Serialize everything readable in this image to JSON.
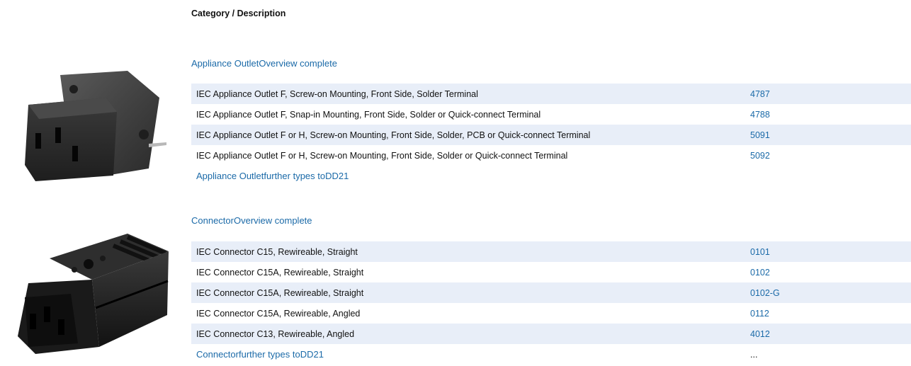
{
  "header": {
    "title": "Category / Description"
  },
  "sections": [
    {
      "title": "Appliance OutletOverview complete",
      "image_icon": "iec-appliance-outlet-image",
      "rows": [
        {
          "description": "IEC Appliance Outlet F, Screw-on Mounting, Front Side, Solder Terminal",
          "code": "4787"
        },
        {
          "description": "IEC Appliance Outlet F, Snap-in Mounting, Front Side, Solder or Quick-connect Terminal",
          "code": "4788"
        },
        {
          "description": "IEC Appliance Outlet F or H, Screw-on Mounting, Front Side, Solder, PCB or Quick-connect Terminal",
          "code": "5091"
        },
        {
          "description": "IEC Appliance Outlet F or H, Screw-on Mounting, Front Side, Solder or Quick-connect Terminal",
          "code": "5092"
        }
      ],
      "further": {
        "label": "Appliance Outletfurther types toDD21",
        "extra": ""
      }
    },
    {
      "title": "ConnectorOverview complete",
      "image_icon": "iec-connector-image",
      "rows": [
        {
          "description": "IEC Connector C15, Rewireable, Straight",
          "code": "0101"
        },
        {
          "description": "IEC Connector C15A, Rewireable, Straight",
          "code": "0102"
        },
        {
          "description": "IEC Connector C15A, Rewireable, Straight",
          "code": "0102-G"
        },
        {
          "description": "IEC Connector C15A, Rewireable, Angled",
          "code": "0112"
        },
        {
          "description": "IEC Connector C13, Rewireable, Angled",
          "code": "4012"
        }
      ],
      "further": {
        "label": "Connectorfurther types toDD21",
        "extra": "..."
      }
    }
  ],
  "colors": {
    "link": "#1b6aa8",
    "row_shade": "#e8eef8",
    "text": "#111111"
  }
}
